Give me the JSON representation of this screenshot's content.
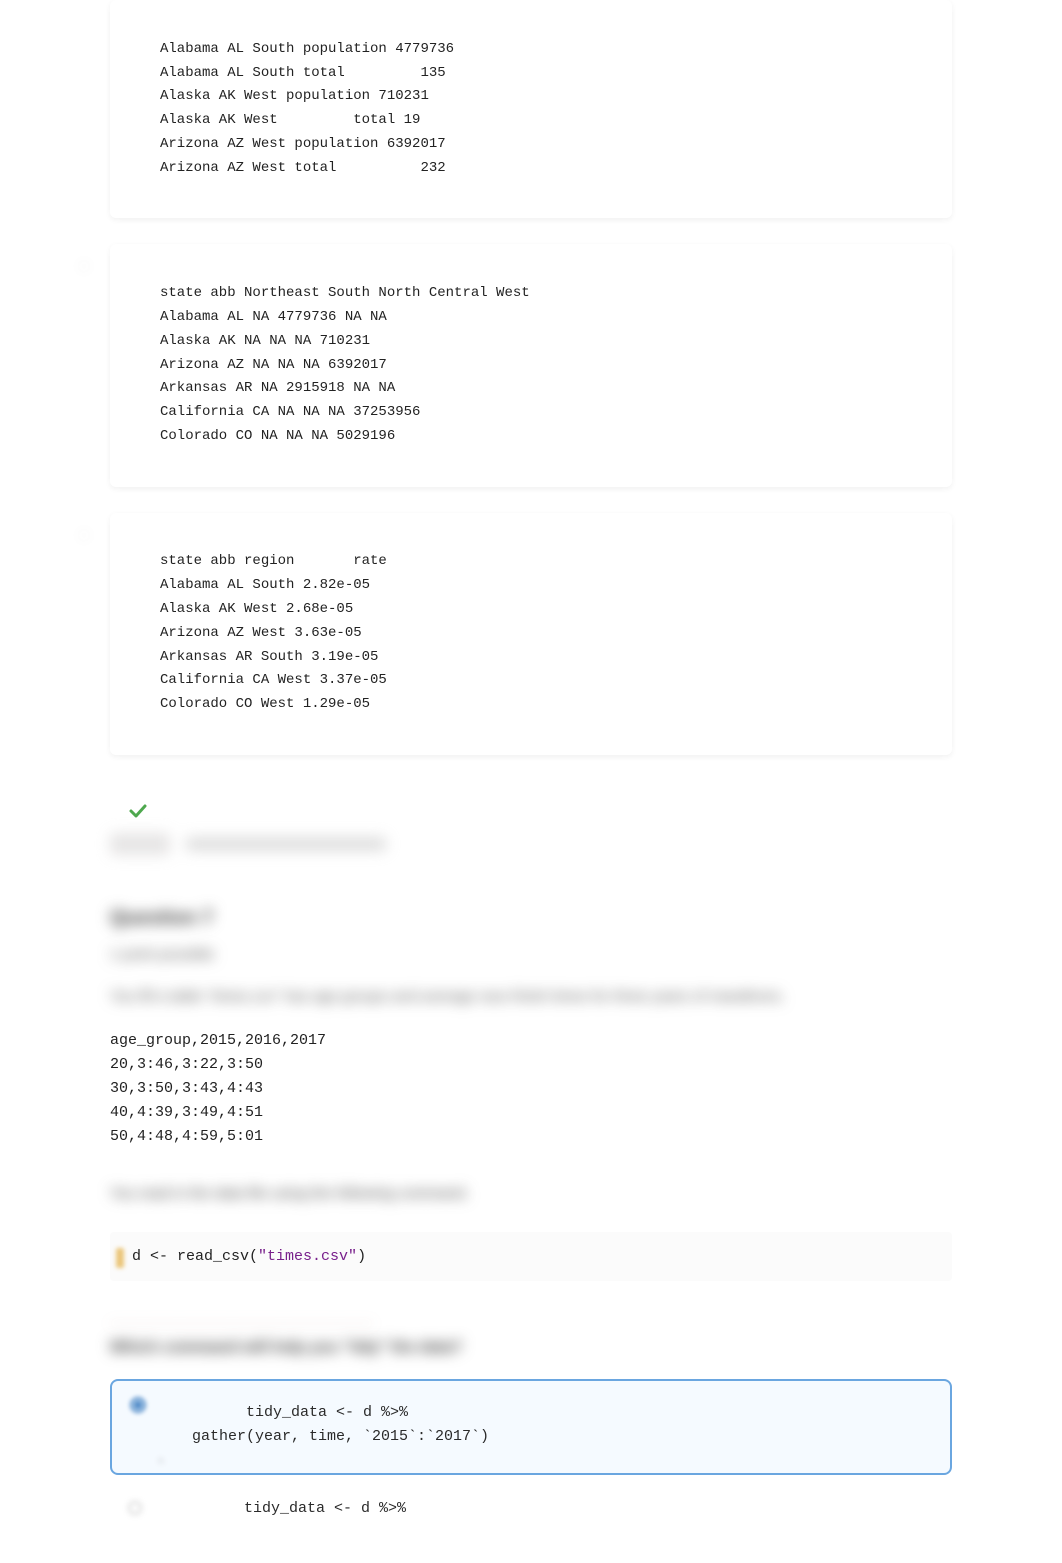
{
  "output_block_1": {
    "lines": [
      "Alabama AL South population 4779736",
      "Alabama AL South total         135",
      "Alaska AK West population 710231",
      "Alaska AK West         total 19",
      "Arizona AZ West population 6392017",
      "Arizona AZ West total          232"
    ]
  },
  "output_block_2": {
    "lines": [
      "state abb Northeast South North Central West",
      "Alabama AL NA 4779736 NA NA",
      "Alaska AK NA NA NA 710231",
      "Arizona AZ NA NA NA 6392017",
      "Arkansas AR NA 2915918 NA NA",
      "California CA NA NA NA 37253956",
      "Colorado CO NA NA NA 5029196"
    ]
  },
  "output_block_3": {
    "lines": [
      "state abb region       rate",
      "Alabama AL South 2.82e-05",
      "Alaska AK West 2.68e-05",
      "Arizona AZ West 3.63e-05",
      "Arkansas AR South 3.19e-05",
      "California CA West 3.37e-05",
      "Colorado CO West 1.29e-05"
    ]
  },
  "section_heading": "Question 7",
  "blurred_para_1": "1 point possible",
  "blurred_para_2": "You fill a table \"times.csv\" has age groups and average race finish times for three years of marathons.",
  "csv_block": "age_group,2015,2016,2017\n20,3:46,3:22,3:50\n30,3:50,3:43,4:43\n40,4:39,3:49,4:51\n50,4:48,4:59,5:01",
  "blurred_instr": "You read in the data file using the following command.",
  "code_1": {
    "prefix": "d <- read_csv(",
    "string": "\"times.csv\"",
    "suffix": ")"
  },
  "blurred_span": " .............................................",
  "question_line": "Which command will help you \"tidy\" the data?",
  "answer_a": "      tidy_data <- d %>%\ngather(year, time, `2015`:`2017`)",
  "answer_b_line1": "      tidy_data <- d %>%"
}
